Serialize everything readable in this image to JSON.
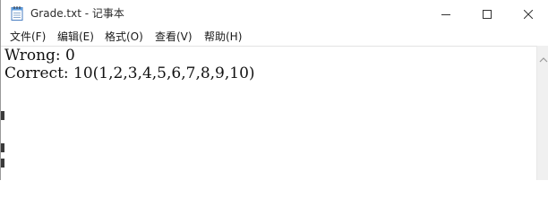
{
  "window": {
    "title": "Grade.txt - 记事本",
    "icon": "notepad-icon"
  },
  "menu": [
    {
      "label": "文件(F)"
    },
    {
      "label": "编辑(E)"
    },
    {
      "label": "格式(O)"
    },
    {
      "label": "查看(V)"
    },
    {
      "label": "帮助(H)"
    }
  ],
  "editor": {
    "lines": [
      "Wrong: 0",
      "Correct: 10(1,2,3,4,5,6,7,8,9,10)"
    ]
  },
  "icons": {
    "minimize": "minimize-icon",
    "maximize": "maximize-icon",
    "close": "close-icon",
    "scroll_up": "scroll-up-arrow-icon"
  }
}
